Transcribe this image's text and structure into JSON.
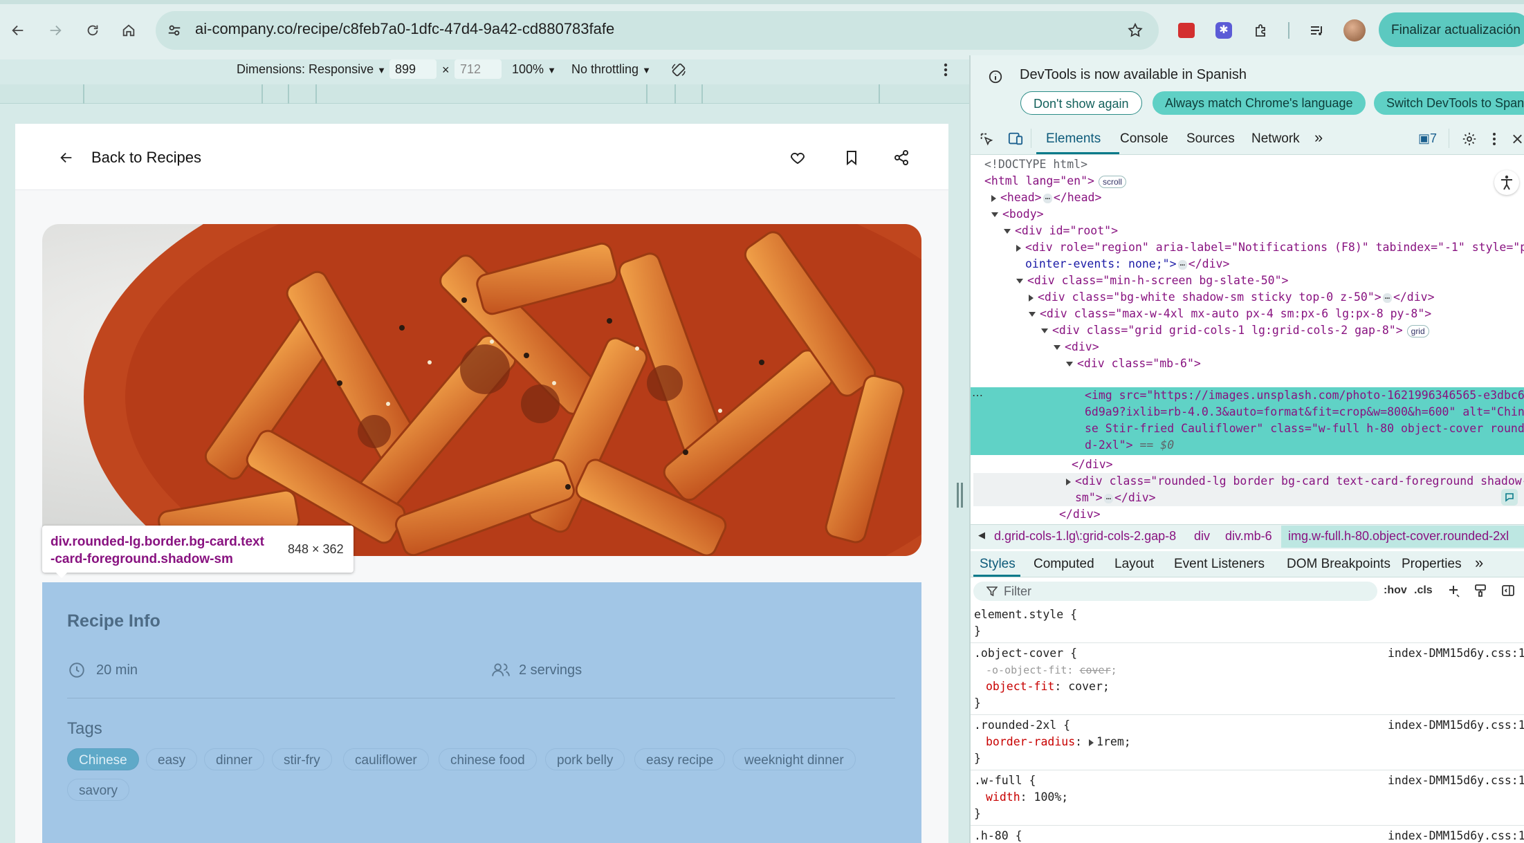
{
  "browser": {
    "url_host": "ai-company.co",
    "url_path": "/recipe/c8feb7a0-1dfc-47d4-9a42-cd880783fafe",
    "update_button": "Finalizar actualización"
  },
  "device_toolbar": {
    "dimensions_label": "Dimensions: Responsive",
    "width": "899",
    "times": "×",
    "height": "712",
    "zoom": "100%",
    "throttling": "No throttling"
  },
  "page": {
    "back_label": "Back to Recipes",
    "recipe_info_title": "Recipe Info",
    "time": "20 min",
    "servings": "2 servings",
    "tags_title": "Tags",
    "tags": [
      "Chinese",
      "easy",
      "dinner",
      "stir-fry",
      "cauliflower",
      "chinese food",
      "pork belly",
      "easy recipe",
      "weeknight dinner",
      "savory"
    ]
  },
  "inspect_tooltip": {
    "selector_line1": "div.rounded-lg.border.bg-card.text",
    "selector_line2": "-card-foreground.shadow-sm",
    "size": "848 × 362"
  },
  "devtools": {
    "info_message": "DevTools is now available in Spanish",
    "btn_dont_show": "Don't show again",
    "btn_match_language": "Always match Chrome's language",
    "btn_switch": "Switch DevTools to Span",
    "tabs": [
      "Elements",
      "Console",
      "Sources",
      "Network"
    ],
    "issues_count": "7",
    "dom_lines": {
      "doctype": "<!DOCTYPE html>",
      "html_open": "<html lang=\"en\">",
      "html_badge": "scroll",
      "head": "<head>",
      "head_close": "</head>",
      "body": "<body>",
      "root": "<div id=\"root\">",
      "region_a": "<div role=\"region\" aria-label=\"Notifications (F8)\" tabindex=\"-1\" style=\"p",
      "region_b": "ointer-events: none;\">",
      "region_close": "</div>",
      "minh": "<div class=\"min-h-screen bg-slate-50\">",
      "sticky": "<div class=\"bg-white shadow-sm sticky top-0 z-50\">",
      "sticky_close": "</div>",
      "maxw": "<div class=\"max-w-4xl mx-auto px-4 sm:px-6 lg:px-8 py-8\">",
      "grid": "<div class=\"grid grid-cols-1 lg:grid-cols-2 gap-8\">",
      "grid_badge": "grid",
      "div": "<div>",
      "mb6": "<div class=\"mb-6\">",
      "img1": "<img src=\"https://images.unsplash.com/photo-1621996346565-e3dbc6",
      "img2": "6d9a9?ixlib=rb-4.0.3&auto=format&fit=crop&w=800&h=600\" alt=\"Chine",
      "img3": "se Stir-fried Cauliflower\" class=\"w-full h-80 object-cover rounde",
      "img4": "d-2xl\">",
      "img4_eq": " == $0",
      "div_close": "</div>",
      "card_a": "<div class=\"rounded-lg border bg-card text-card-foreground shadow-",
      "card_b": "sm\">",
      "card_close": "</div>",
      "div_close2": "</div>"
    },
    "breadcrumbs": [
      "d.grid-cols-1.lg\\:grid-cols-2.gap-8",
      "div",
      "div.mb-6",
      "img.w-full.h-80.object-cover.rounded-2xl"
    ],
    "style_tabs": [
      "Styles",
      "Computed",
      "Layout",
      "Event Listeners",
      "DOM Breakpoints",
      "Properties"
    ],
    "filter_placeholder": "Filter",
    "hov": ":hov",
    "cls": ".cls",
    "rules": {
      "element_style": "element.style {",
      "close": "}",
      "object_cover": ".object-cover {",
      "oof_prop": "-o-object-fit",
      "oof_val": "cover",
      "of_prop": "object-fit",
      "of_val": "cover",
      "rounded": ".rounded-2xl {",
      "br_prop": "border-radius",
      "br_val": "1rem",
      "wfull": ".w-full {",
      "w_prop": "width",
      "w_val": "100%",
      "h80": ".h-80 {",
      "source": "index-DMM15d6y.css:1"
    }
  }
}
